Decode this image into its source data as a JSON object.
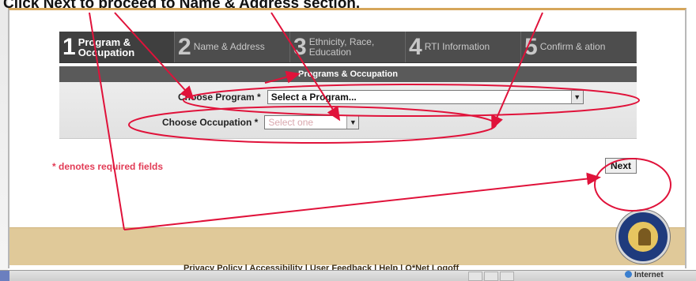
{
  "caption": "Click Next to proceed to Name & Address section.",
  "steps": [
    {
      "number": "1",
      "label": "Program & Occupation",
      "active": true
    },
    {
      "number": "2",
      "label": "Name & Address",
      "active": false
    },
    {
      "number": "3",
      "label": "Ethnicity, Race, Education",
      "active": false
    },
    {
      "number": "4",
      "label": "RTI Information",
      "active": false
    },
    {
      "number": "5",
      "label": "Confirm & ation",
      "active": false
    }
  ],
  "section_title": "Programs & Occupation",
  "form": {
    "program_label": "Choose Program *",
    "program_value": "Select a Program...",
    "occupation_label": "Choose Occupation *",
    "occupation_value": "Select one"
  },
  "required_note": "* denotes required fields",
  "next_label": "Next",
  "footer_links": "Privacy Policy | Accessibility | User Feedback | Help | O*Net Logoff",
  "status": {
    "zone": "Internet"
  },
  "colors": {
    "annotation": "#e0123a",
    "required": "#e23c56",
    "footer": "#e0c999",
    "steps": "#4d4d4d"
  }
}
